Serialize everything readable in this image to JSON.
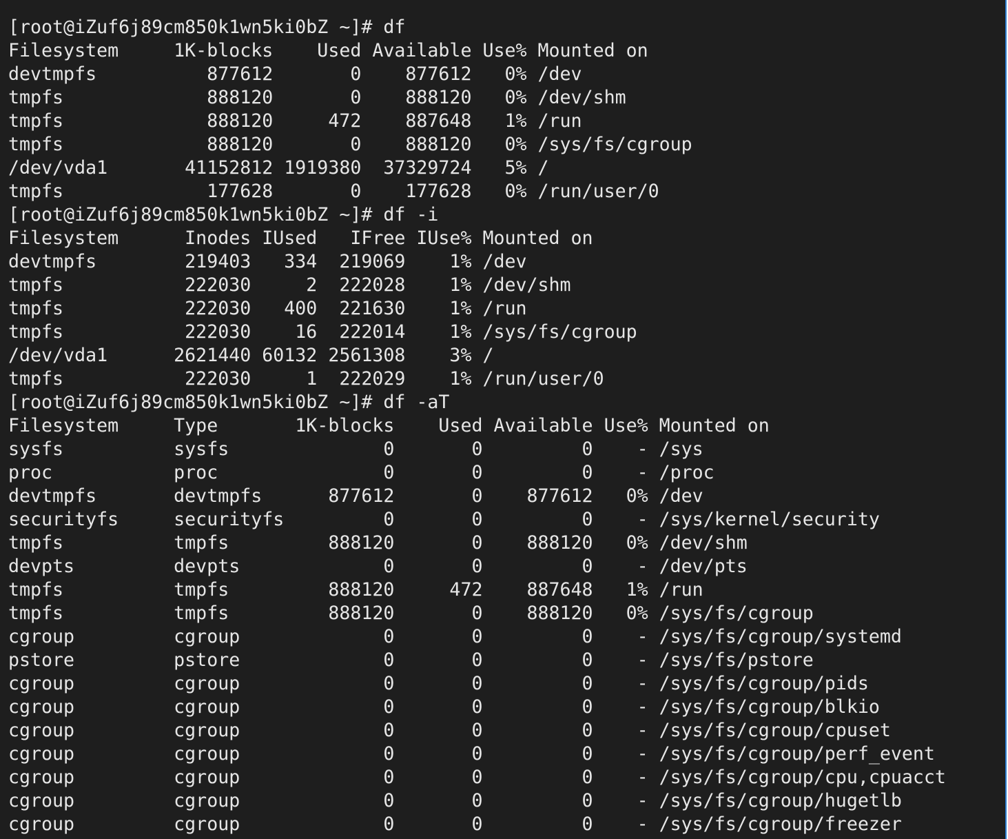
{
  "terminal": {
    "lines": [
      "[root@iZuf6j89cm850k1wn5ki0bZ ~]# df",
      "Filesystem     1K-blocks    Used Available Use% Mounted on",
      "devtmpfs          877612       0    877612   0% /dev",
      "tmpfs             888120       0    888120   0% /dev/shm",
      "tmpfs             888120     472    887648   1% /run",
      "tmpfs             888120       0    888120   0% /sys/fs/cgroup",
      "/dev/vda1       41152812 1919380  37329724   5% /",
      "tmpfs             177628       0    177628   0% /run/user/0",
      "[root@iZuf6j89cm850k1wn5ki0bZ ~]# df -i",
      "Filesystem      Inodes IUsed   IFree IUse% Mounted on",
      "devtmpfs        219403   334  219069    1% /dev",
      "tmpfs           222030     2  222028    1% /dev/shm",
      "tmpfs           222030   400  221630    1% /run",
      "tmpfs           222030    16  222014    1% /sys/fs/cgroup",
      "/dev/vda1      2621440 60132 2561308    3% /",
      "tmpfs           222030     1  222029    1% /run/user/0",
      "[root@iZuf6j89cm850k1wn5ki0bZ ~]# df -aT",
      "Filesystem     Type       1K-blocks    Used Available Use% Mounted on",
      "sysfs          sysfs              0       0         0    - /sys",
      "proc           proc               0       0         0    - /proc",
      "devtmpfs       devtmpfs      877612       0    877612   0% /dev",
      "securityfs     securityfs         0       0         0    - /sys/kernel/security",
      "tmpfs          tmpfs         888120       0    888120   0% /dev/shm",
      "devpts         devpts             0       0         0    - /dev/pts",
      "tmpfs          tmpfs         888120     472    887648   1% /run",
      "tmpfs          tmpfs         888120       0    888120   0% /sys/fs/cgroup",
      "cgroup         cgroup             0       0         0    - /sys/fs/cgroup/systemd",
      "pstore         pstore             0       0         0    - /sys/fs/pstore",
      "cgroup         cgroup             0       0         0    - /sys/fs/cgroup/pids",
      "cgroup         cgroup             0       0         0    - /sys/fs/cgroup/blkio",
      "cgroup         cgroup             0       0         0    - /sys/fs/cgroup/cpuset",
      "cgroup         cgroup             0       0         0    - /sys/fs/cgroup/perf_event",
      "cgroup         cgroup             0       0         0    - /sys/fs/cgroup/cpu,cpuacct",
      "cgroup         cgroup             0       0         0    - /sys/fs/cgroup/hugetlb",
      "cgroup         cgroup             0       0         0    - /sys/fs/cgroup/freezer"
    ]
  },
  "colors": {
    "background": "#1e1e1e",
    "text": "#e6e6e6",
    "window_border": "#2f7fd0"
  }
}
